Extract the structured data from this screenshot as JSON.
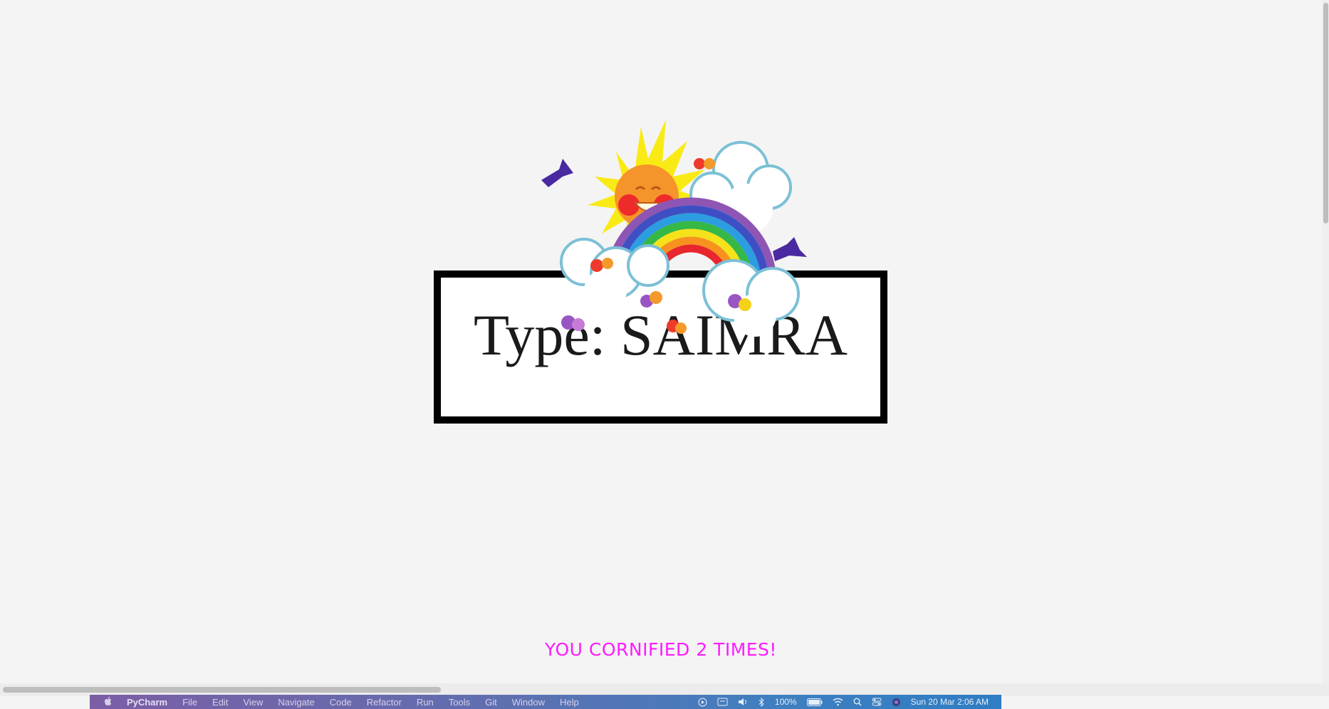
{
  "prompt": {
    "text": "Type: SAIMRA"
  },
  "counter": {
    "text": "YOU CORNIFIED 2 TIMES!"
  },
  "menubar": {
    "app_name": "PyCharm",
    "items": [
      "File",
      "Edit",
      "View",
      "Navigate",
      "Code",
      "Refactor",
      "Run",
      "Tools",
      "Git",
      "Window",
      "Help"
    ],
    "battery": "100%",
    "clock": "Sun 20 Mar  2:06 AM"
  },
  "colors": {
    "background": "#f4f4f4",
    "counter_text": "#ff1aff",
    "box_border": "#000000"
  },
  "icons": [
    "apple-icon",
    "play-icon",
    "display-icon",
    "volume-icon",
    "bluetooth-icon",
    "battery-icon",
    "wifi-icon",
    "search-icon",
    "control-center-icon",
    "siri-icon"
  ]
}
